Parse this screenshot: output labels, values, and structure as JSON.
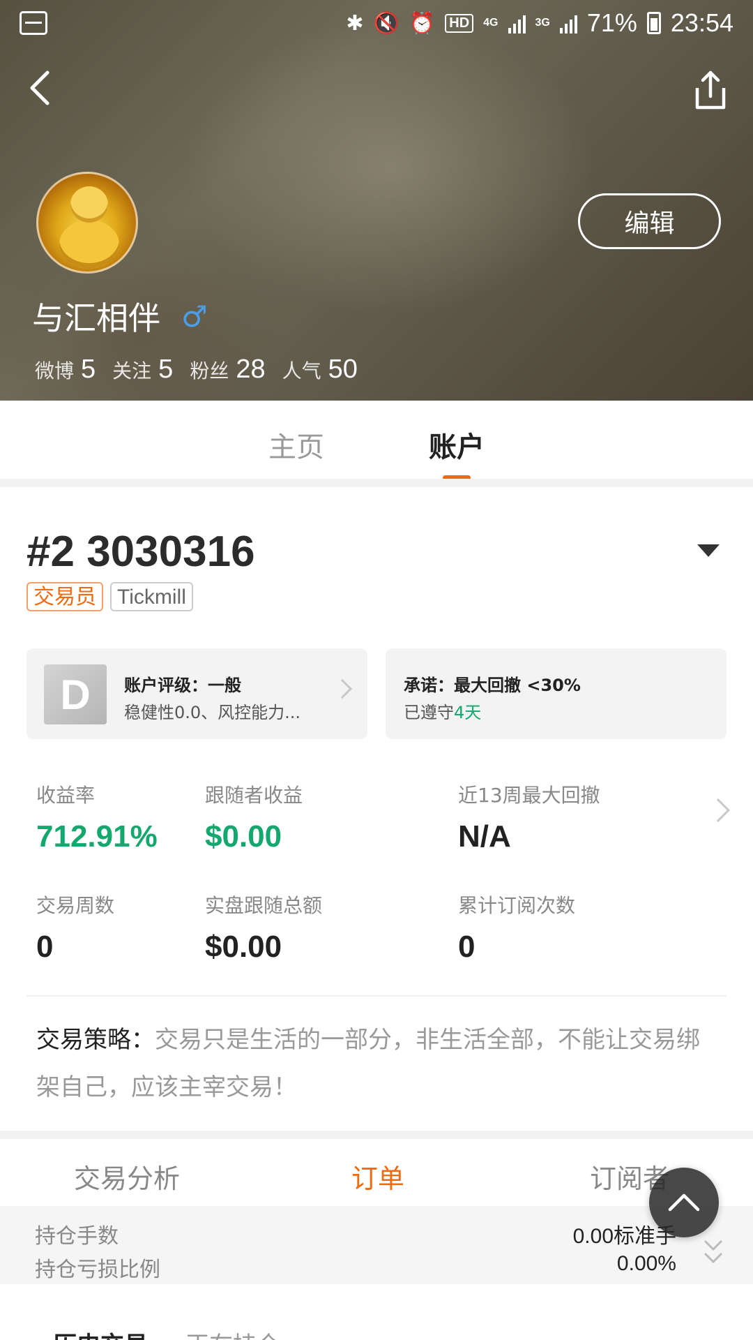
{
  "status_bar": {
    "battery": "71%",
    "time": "23:54",
    "hd": "HD",
    "net1": "4G",
    "net2": "3G"
  },
  "profile": {
    "username": "与汇相伴",
    "gender_symbol": "♂",
    "edit_label": "编辑",
    "stats": [
      {
        "label": "微博",
        "value": "5"
      },
      {
        "label": "关注",
        "value": "5"
      },
      {
        "label": "粉丝",
        "value": "28"
      },
      {
        "label": "人气",
        "value": "50"
      }
    ]
  },
  "main_tabs": [
    {
      "label": "主页",
      "active": false
    },
    {
      "label": "账户",
      "active": true
    }
  ],
  "account": {
    "id": "#2 3030316",
    "tags": [
      "交易员",
      "Tickmill"
    ],
    "rating_card": {
      "grade": "D",
      "title": "账户评级：一般",
      "subtitle": "稳健性0.0、风控能力..."
    },
    "commit_card": {
      "title": "承诺：最大回撤 <30%",
      "subtitle_prefix": "已遵守",
      "days": "4天"
    },
    "metrics": [
      {
        "label": "收益率",
        "value": "712.91%"
      },
      {
        "label": "跟随者收益",
        "value": "$0.00"
      },
      {
        "label": "近13周最大回撤",
        "value": "N/A"
      },
      {
        "label": "交易周数",
        "value": "0"
      },
      {
        "label": "实盘跟随总额",
        "value": "$0.00"
      },
      {
        "label": "累计订阅次数",
        "value": "0"
      }
    ],
    "strategy_label": "交易策略：",
    "strategy_text": "交易只是生活的一部分，非生活全部，不能让交易绑架自己，应该主宰交易！"
  },
  "sub_tabs": [
    {
      "label": "交易分析",
      "active": false
    },
    {
      "label": "订单",
      "active": true
    },
    {
      "label": "订阅者",
      "active": false
    }
  ],
  "summary": [
    {
      "label": "持仓手数",
      "value": "0.00标准手"
    },
    {
      "label": "持仓亏损比例",
      "value": "0.00%"
    }
  ],
  "history_tabs": [
    {
      "label": "历史交易",
      "active": true
    },
    {
      "label": "正在持仓",
      "active": false
    }
  ],
  "colors": {
    "accent": "#f06a0f",
    "positive": "#14a86e",
    "gender": "#4a9ee8"
  }
}
